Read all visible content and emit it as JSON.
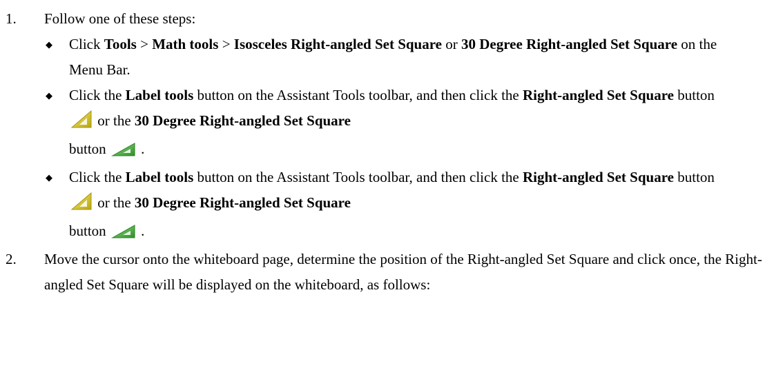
{
  "step1": {
    "number": "1.",
    "intro": "Follow one of these steps:",
    "options": [
      {
        "t1": "Click ",
        "b1": "Tools",
        "t2": " > ",
        "b2": "Math tools",
        "t3": " > ",
        "b3": "Isosceles Right-angled Set Square",
        "t4": " or ",
        "b4": "30 Degree Right-angled Set Square",
        "t5": " on the Menu Bar."
      },
      {
        "t1": "Click the ",
        "b1": "Label tools",
        "t2": " button on the Assistant Tools toolbar, and then click the ",
        "b2": "Right-angled Set Square",
        "t3": " button ",
        "t4": " or the ",
        "b3": "30 Degree Right-angled Set Square",
        "t5": "button ",
        "t6": " .",
        "icon1": "yellow-set-square-icon",
        "icon2": "green-30-degree-set-square-icon"
      },
      {
        "t1": "Click the ",
        "b1": "Label tools",
        "t2": " button on the Assistant Tools toolbar, and then click the ",
        "b2": "Right-angled Set Square",
        "t3": " button ",
        "t4": " or the ",
        "b3": "30 Degree Right-angled Set Square",
        "t5": "button ",
        "t6": " .",
        "icon1": "yellow-set-square-icon",
        "icon2": "green-30-degree-set-square-icon"
      }
    ],
    "bullet": "◆"
  },
  "step2": {
    "number": "2.",
    "text": "Move the cursor onto the whiteboard page, determine the position of the Right-angled Set Square and click once, the Right-angled Set Square will be displayed on the whiteboard, as follows:"
  },
  "colors": {
    "yellow_icon": "#d9c81e",
    "green_icon": "#3fae3a"
  }
}
